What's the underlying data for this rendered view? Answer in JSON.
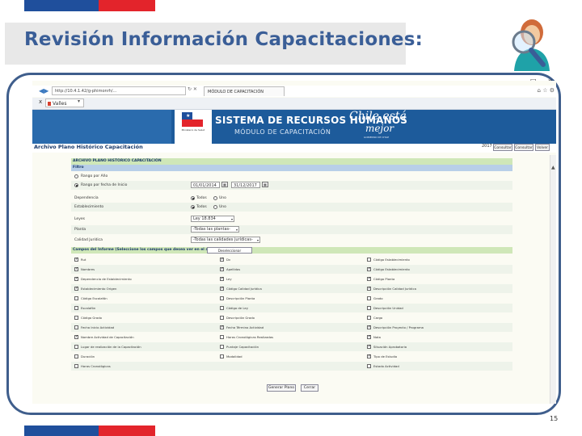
{
  "slide": {
    "title": "Revisión Información Capacitaciones:",
    "page_number": "15"
  },
  "window": {
    "minimize": "–",
    "maximize": "□",
    "close": "x"
  },
  "browser": {
    "url": "http://10.4.1.42/g-phimonrh/...",
    "addr_controls": "↻ ✕",
    "tab_label": "MÓDULO DE CAPACITACIÓN",
    "toolbar_icons": "⌂ ☆ ⚙",
    "fav_close": "x",
    "fav_button": "Valles"
  },
  "banner": {
    "title": "SISTEMA DE RECURSOS HUMANOS",
    "subtitle": "MÓDULO DE CAPACITACIÓN",
    "script_line1": "Chile está",
    "script_line2": "mejor",
    "gov_caption": "GOBIERNO DE CHILE",
    "logo_caption": "Ministerio de Salud"
  },
  "page": {
    "title": "Archivo Plano Histórico Capacitación",
    "year": "2017",
    "buttons": [
      "Consultar",
      "Consultar",
      "Volver"
    ]
  },
  "form": {
    "section_header": "ARCHIVO PLANO HISTÓRICO CAPACITACIÓN",
    "filter_header": "Filtro",
    "filter_options": [
      "Rango por Año",
      "Rango por fecha de Inicio"
    ],
    "date_from": "01/01/2014",
    "date_to": "31/12/2017",
    "calendar_glyph": "▦",
    "rows": [
      {
        "label": "Dependencia",
        "type": "radio",
        "options": [
          "Todos",
          "Uno"
        ]
      },
      {
        "label": "Establecimiento",
        "type": "radio",
        "options": [
          "Todos",
          "Uno"
        ]
      },
      {
        "label": "Leyes",
        "type": "select",
        "value": "Ley 18.834"
      },
      {
        "label": "Planta",
        "type": "select",
        "value": "-Todas las plantas-"
      },
      {
        "label": "Calidad Jurídica",
        "type": "select",
        "value": "-Todas las calidades jurídicas-"
      }
    ],
    "fields_header": "Campos del Informe (Seleccione los campos que desea ver en el archivo plano)",
    "deselect_button": "Deseleccionar",
    "check_glyph": "✓",
    "checkbox_columns": [
      [
        {
          "label": "Rut",
          "checked": true
        },
        {
          "label": "Nombres",
          "checked": true
        },
        {
          "label": "Dependencia de Establecimiento",
          "checked": true
        },
        {
          "label": "Establecimiento Origen",
          "checked": true
        },
        {
          "label": "Código Escalafón",
          "checked": false
        },
        {
          "label": "Escalafón",
          "checked": false
        },
        {
          "label": "Código Grado",
          "checked": false
        },
        {
          "label": "Fecha Inicio Actividad",
          "checked": false
        },
        {
          "label": "Nombre Actividad de Capacitación",
          "checked": true
        },
        {
          "label": "Lugar de realización de la Capacitación",
          "checked": false
        },
        {
          "label": "Duración",
          "checked": false
        },
        {
          "label": "Horas Cronológicas",
          "checked": false
        }
      ],
      [
        {
          "label": "Dv",
          "checked": true
        },
        {
          "label": "Apellidos",
          "checked": true
        },
        {
          "label": "Ley",
          "checked": true
        },
        {
          "label": "Código Calidad Jurídica",
          "checked": true
        },
        {
          "label": "Descripción Planta",
          "checked": false
        },
        {
          "label": "Código de Ley",
          "checked": false
        },
        {
          "label": "Descripción Grado",
          "checked": false
        },
        {
          "label": "Fecha Término Actividad",
          "checked": true
        },
        {
          "label": "Horas Cronológicas Realizadas",
          "checked": false
        },
        {
          "label": "Puntaje Capacitación",
          "checked": false
        },
        {
          "label": "Modalidad",
          "checked": false
        }
      ],
      [
        {
          "label": "Código Establecimiento",
          "checked": false
        },
        {
          "label": "Código Establecimiento",
          "checked": true
        },
        {
          "label": "Código Planta",
          "checked": true
        },
        {
          "label": "Descripción Calidad Jurídica",
          "checked": true
        },
        {
          "label": "Grado",
          "checked": false
        },
        {
          "label": "Descripción Unidad",
          "checked": false
        },
        {
          "label": "Cargo",
          "checked": false
        },
        {
          "label": "Descripción Proyecto / Programa",
          "checked": true
        },
        {
          "label": "Nota",
          "checked": true
        },
        {
          "label": "Situación Aprobatoria",
          "checked": true
        },
        {
          "label": "Tipo de Estudio",
          "checked": true
        },
        {
          "label": "Estado Actividad",
          "checked": false
        }
      ]
    ],
    "generate_button": "Generar Plano",
    "close_button": "Cerrar"
  },
  "colors": {
    "title": "#3a5e97",
    "frame": "#3f5e8c",
    "banner": "#1d5b9b",
    "section_green": "#cfe7b8",
    "flag_blue": "#1f4f9c",
    "flag_red": "#e3242b"
  }
}
